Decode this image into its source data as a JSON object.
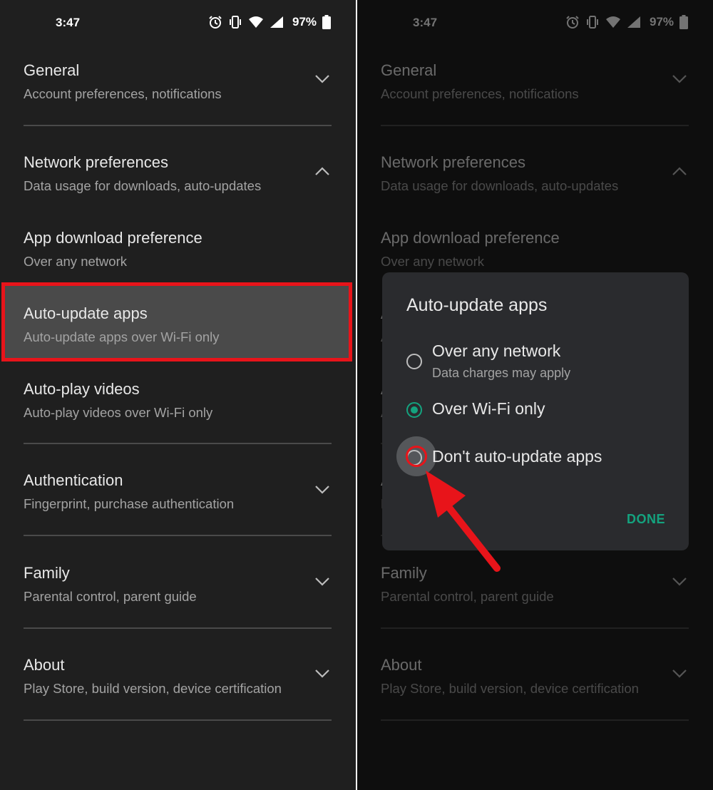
{
  "status": {
    "time": "3:47",
    "battery": "97%",
    "icons": [
      "alarm-icon",
      "vibrate-icon",
      "wifi-icon",
      "signal-icon",
      "battery-icon"
    ]
  },
  "settings": {
    "general": {
      "title": "General",
      "subtitle": "Account preferences, notifications"
    },
    "network": {
      "title": "Network preferences",
      "subtitle": "Data usage for downloads, auto-updates"
    },
    "app_download": {
      "title": "App download preference",
      "subtitle": "Over any network"
    },
    "auto_update": {
      "title": "Auto-update apps",
      "subtitle": "Auto-update apps over Wi-Fi only"
    },
    "auto_play": {
      "title": "Auto-play videos",
      "subtitle": "Auto-play videos over Wi-Fi only"
    },
    "authentication": {
      "title": "Authentication",
      "subtitle": "Fingerprint, purchase authentication"
    },
    "family": {
      "title": "Family",
      "subtitle": "Parental control, parent guide"
    },
    "about": {
      "title": "About",
      "subtitle": "Play Store, build version, device certification"
    }
  },
  "dialog": {
    "title": "Auto-update apps",
    "options": [
      {
        "label": "Over any network",
        "subtitle": "Data charges may apply",
        "selected": false
      },
      {
        "label": "Over Wi-Fi only",
        "selected": true
      },
      {
        "label": "Don't auto-update apps",
        "selected": false
      }
    ],
    "done_label": "DONE"
  },
  "colors": {
    "background": "#1f1f1f",
    "accent": "#14a37f",
    "highlight": "#e8141a",
    "dialog": "#2a2b2e"
  }
}
